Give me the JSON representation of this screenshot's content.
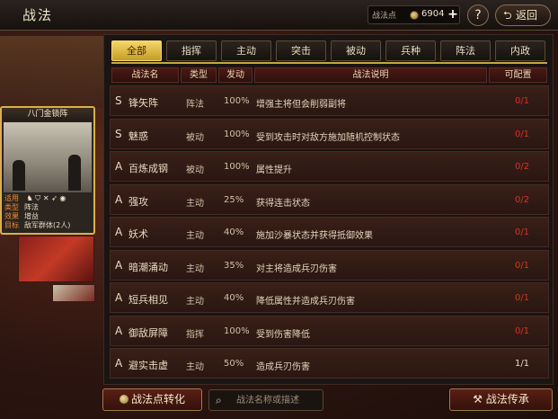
{
  "header": {
    "title": "战法",
    "points_label": "战法点",
    "points_value": "6904",
    "plus_label": "+",
    "help_label": "?",
    "back_label": "返回"
  },
  "tabs": [
    "全部",
    "指挥",
    "主动",
    "突击",
    "被动",
    "兵种",
    "阵法",
    "内政"
  ],
  "active_tab": "全部",
  "table": {
    "headers": [
      "战法名",
      "类型",
      "发动",
      "战法说明",
      "可配置"
    ],
    "rows": [
      {
        "grade": "S",
        "name": "锋矢阵",
        "type": "阵法",
        "rate": "100%",
        "desc": "增强主将但会削弱副将",
        "config": "0/1",
        "status_color": "#d6331f"
      },
      {
        "grade": "S",
        "name": "魅惑",
        "type": "被动",
        "rate": "100%",
        "desc": "受到攻击时对敌方施加随机控制状态",
        "config": "0/1",
        "status_color": "#d6331f"
      },
      {
        "grade": "A",
        "name": "百炼成钢",
        "type": "被动",
        "rate": "100%",
        "desc": "属性提升",
        "config": "0/2",
        "status_color": "#d6331f"
      },
      {
        "grade": "A",
        "name": "强攻",
        "type": "主动",
        "rate": "25%",
        "desc": "获得连击状态",
        "config": "0/2",
        "status_color": "#d6331f"
      },
      {
        "grade": "A",
        "name": "妖术",
        "type": "主动",
        "rate": "40%",
        "desc": "施加沙暴状态并获得抵御效果",
        "config": "0/1",
        "status_color": "#d6331f"
      },
      {
        "grade": "A",
        "name": "暗潮涌动",
        "type": "主动",
        "rate": "35%",
        "desc": "对主将造成兵刃伤害",
        "config": "0/1",
        "status_color": "#d6331f"
      },
      {
        "grade": "A",
        "name": "短兵相见",
        "type": "主动",
        "rate": "40%",
        "desc": "降低属性并造成兵刃伤害",
        "config": "0/1",
        "status_color": "#d6331f"
      },
      {
        "grade": "A",
        "name": "御敌屏障",
        "type": "指挥",
        "rate": "100%",
        "desc": "受到伤害降低",
        "config": "0/1",
        "status_color": "#d6331f"
      },
      {
        "grade": "A",
        "name": "避实击虚",
        "type": "主动",
        "rate": "50%",
        "desc": "造成兵刃伤害",
        "config": "1/1",
        "status_color": "#e8dcc4"
      }
    ]
  },
  "card": {
    "title": "八门金锁阵",
    "lines": [
      {
        "key": "适用",
        "value": ""
      },
      {
        "key": "类型",
        "value": "阵法"
      },
      {
        "key": "效果",
        "value": "增益"
      },
      {
        "key": "目标",
        "value": "敌军群体(2人)"
      }
    ],
    "troop_icons": [
      "cavalry-icon",
      "shield-icon",
      "crossed-spears-icon",
      "bow-icon",
      "siege-icon"
    ]
  },
  "bottom": {
    "convert_label": "战法点转化",
    "search_placeholder": "战法名称或描述",
    "transmit_label": "战法传承"
  },
  "colors": {
    "accent_gold": "#c9a640",
    "tab_active": "#e8c54a",
    "config_red": "#d6331f"
  }
}
